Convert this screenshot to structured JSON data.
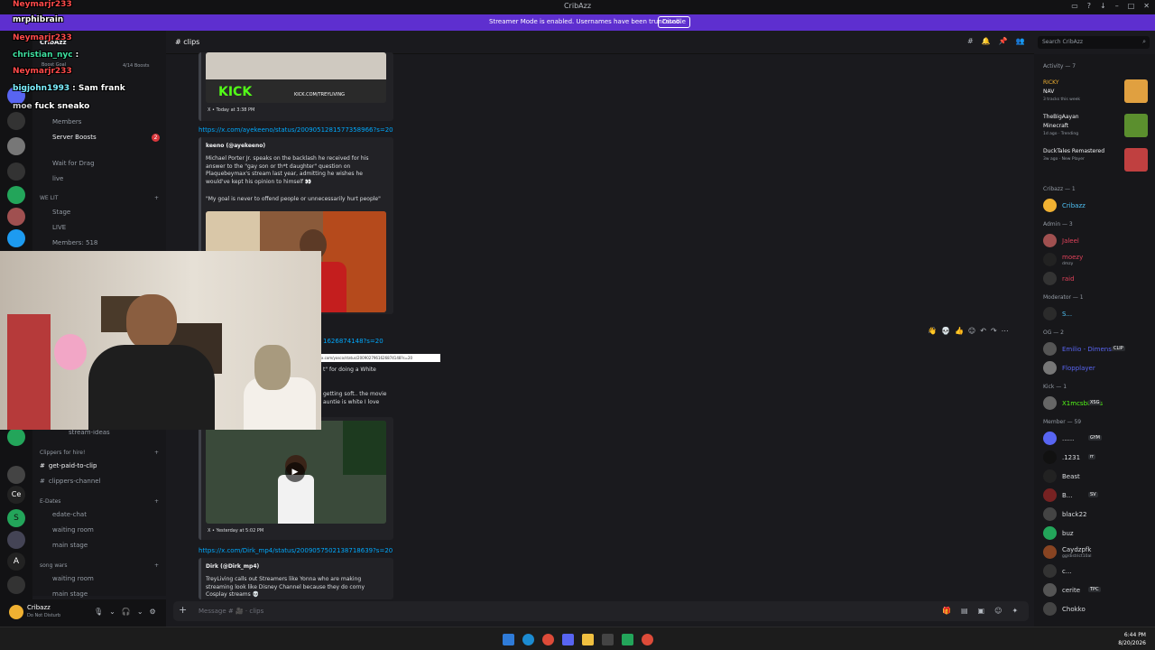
{
  "window": {
    "title": "CribAzz"
  },
  "banner": {
    "text": "Streamer Mode is enabled. Usernames have been truncated.",
    "button": "Disable"
  },
  "overlay_chat": [
    {
      "user": "Neymarjr233",
      "msg": ""
    },
    {
      "user": "mrphibrain",
      "msg": ""
    },
    {
      "user": "Neymarjr233",
      "msg": ""
    },
    {
      "user": "christian_nyc",
      "msg": ":"
    },
    {
      "user": "Neymarjr233",
      "msg": ""
    },
    {
      "user": "bigjohn1993",
      "msg": ": Sam frank"
    },
    {
      "user": "moe",
      "msg": "fuck sneako"
    }
  ],
  "server": {
    "name": "CribAzz",
    "boost_goal": "Boost Goal",
    "boosts": "4/14 Boosts"
  },
  "channels": {
    "members_label": "Members",
    "server_boosts": "Server Boosts",
    "server_boosts_badge": "2",
    "wait_for_drag": "Wait for Drag",
    "live": "live",
    "cat_we_lit": "WE LIT",
    "stage": "Stage",
    "live2": "LIVE",
    "members_count": "Members: 518",
    "stream_ideas": "stream-ideas",
    "cat_clippers": "Clippers for hire!",
    "get_paid": "get-paid-to-clip",
    "clippers_channel": "clippers-channel",
    "cat_edates": "E-Dates",
    "edate_chat": "edate-chat",
    "waiting_room": "waiting room",
    "main_stage": "main stage",
    "cat_song_wars": "song wars",
    "waiting_room2": "waiting room",
    "main_stage2": "main stage"
  },
  "user_panel": {
    "name": "Cribazz",
    "status": "Do Not Disturb"
  },
  "chat": {
    "channel": "clips",
    "embed1": {
      "footer": "X • Today at 3:38 PM",
      "kick_text": "KICK",
      "kick_url": "KICK.COM/TREYLIVING"
    },
    "link1": "https://x.com/ayekeeno/status/2009051281577358966?s=20",
    "embed2": {
      "author": "keeno (@ayekeeno)",
      "text1": "Michael Porter Jr. speaks on the backlash he received for his answer to the \"gay son or th*t daughter\" question on Plaquebeymax's stream last year, admitting he wishes he would've kept his opinion to himself 👀",
      "text2": "\"My goal is never to offend people or unnecessarily hurt people\""
    },
    "link2": "1626874148?s=20",
    "tooltip": "x.com/yosco/status/2009027961626874148?s=20",
    "partial1": "t\" for doing a White",
    "partial2": "getting soft.. the movie",
    "partial3": "auntie is white I love",
    "embed3": {
      "footer": "X • Yesterday at 5:02 PM"
    },
    "link3": "https://x.com/Dirk_mp4/status/2009057502138718639?s=20",
    "embed4": {
      "author": "Dirk (@Dirk_mp4)",
      "text": "TreyLiving calls out Streamers like Yonna who are making streaming look like Disney Channel because they do corny Cosplay streams 💀"
    },
    "input_placeholder": "Message # 🎥 · clips"
  },
  "search": {
    "placeholder": "Search CribAzz"
  },
  "members": {
    "activity_header": "Activity — 7",
    "activities": [
      {
        "name": "RICKY",
        "game": "NAV",
        "sub": "3 tracks this week",
        "color": "#e0a040"
      },
      {
        "name": "TheBigAayan",
        "game": "Minecraft",
        "sub": "1d ago · Trending",
        "color": "#5b8f2e"
      },
      {
        "name": "DuckTales Remastered",
        "game": "",
        "sub": "3w ago · New Player",
        "color": "#c04040"
      }
    ],
    "groups": [
      {
        "label": "Cribazz — 1",
        "items": [
          {
            "name": "Cribazz",
            "sub": "",
            "color": "#f0b132",
            "ncolor": "#4fc3f7"
          }
        ]
      },
      {
        "label": "Admin — 3",
        "items": [
          {
            "name": "Jaleel",
            "sub": "",
            "color": "#a05050",
            "ncolor": "#e0425a"
          },
          {
            "name": "moezy",
            "sub": "dmzy",
            "color": "#222",
            "ncolor": "#e0425a"
          },
          {
            "name": "raid",
            "sub": "",
            "color": "#333",
            "ncolor": "#e0425a"
          }
        ]
      },
      {
        "label": "Moderator — 1",
        "items": [
          {
            "name": "S...",
            "sub": "",
            "color": "#2b2b2b",
            "ncolor": "#4fc3f7"
          }
        ]
      },
      {
        "label": "OG — 2",
        "items": [
          {
            "name": "Emilio - Dimension",
            "sub": "",
            "color": "#555",
            "ncolor": "#5865f2",
            "tag": "CLIP"
          },
          {
            "name": "Flopplayer",
            "sub": "",
            "color": "#777",
            "ncolor": "#5865f2"
          }
        ]
      },
      {
        "label": "Kick — 1",
        "items": [
          {
            "name": "X1mcsb8D°s",
            "sub": "",
            "color": "#666",
            "ncolor": "#53fc18",
            "tag": "XSG"
          }
        ]
      },
      {
        "label": "Member — 59",
        "items": [
          {
            "name": "......",
            "sub": "",
            "color": "#5865f2",
            "ncolor": "#dbdee1",
            "tag": "GYM"
          },
          {
            "name": ".1231",
            "sub": "",
            "color": "#111",
            "ncolor": "#dbdee1",
            "tag": "rr"
          },
          {
            "name": "Beast",
            "sub": "",
            "color": "#222",
            "ncolor": "#dbdee1"
          },
          {
            "name": "B...",
            "sub": "",
            "color": "#772222",
            "ncolor": "#dbdee1",
            "tag": "SV"
          },
          {
            "name": "black22",
            "sub": "",
            "color": "#444",
            "ncolor": "#dbdee1"
          },
          {
            "name": "buz",
            "sub": "",
            "color": "#23a55a",
            "ncolor": "#dbdee1"
          },
          {
            "name": "Caydzpfk",
            "sub": "gg/district10al",
            "color": "#884422",
            "ncolor": "#dbdee1"
          },
          {
            "name": "c...",
            "sub": "",
            "color": "#333",
            "ncolor": "#dbdee1"
          },
          {
            "name": "cerite",
            "sub": "",
            "color": "#555",
            "ncolor": "#dbdee1",
            "tag": "TPC"
          },
          {
            "name": "Chokko",
            "sub": "",
            "color": "#444",
            "ncolor": "#dbdee1"
          }
        ]
      }
    ]
  },
  "taskbar": {
    "time": "6:44 PM",
    "date": "8/20/2026"
  },
  "colors": {
    "accent": "#5e2fcf",
    "link": "#00a8fc",
    "bg": "#1a1a1e"
  }
}
